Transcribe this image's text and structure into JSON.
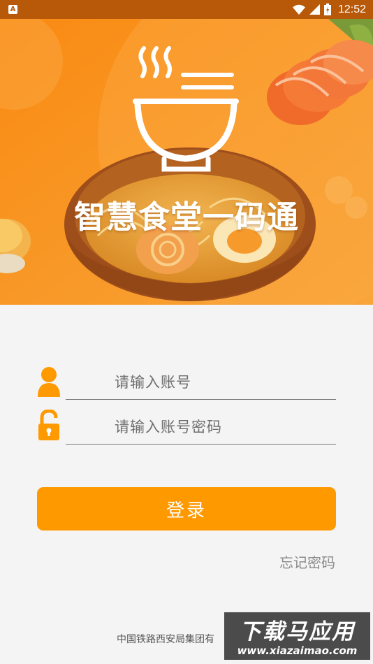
{
  "status_bar": {
    "notification_glyph": "A",
    "time": "12:52",
    "icons": [
      "wifi-icon",
      "signal-icon",
      "battery-icon"
    ]
  },
  "header": {
    "title": "智慧食堂一码通",
    "background_color": "#f7951d"
  },
  "login_form": {
    "account_placeholder": "请输入账号",
    "password_placeholder": "请输入账号密码",
    "login_button": "登录",
    "forgot_password": "忘记密码"
  },
  "footer": {
    "company": "中国铁路西安局集团有"
  },
  "watermark": {
    "title": "下载马应用",
    "url": "www.xiazaimao.com"
  },
  "colors": {
    "accent": "#ff9900",
    "status_bar": "#b8590a",
    "page_background": "#f4f4f4"
  }
}
